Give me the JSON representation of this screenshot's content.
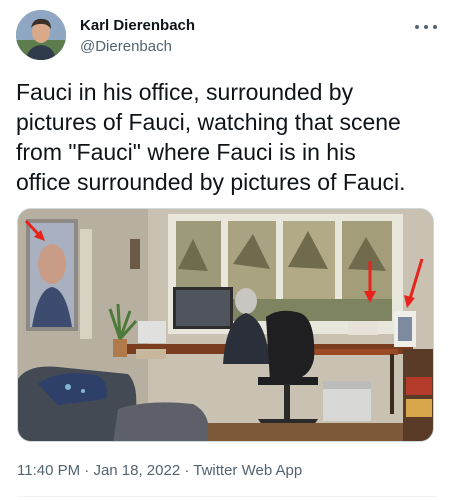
{
  "author": {
    "display_name": "Karl Dierenbach",
    "handle": "@Dierenbach",
    "avatar_icon": "profile-photo"
  },
  "tweet": {
    "text": "Fauci in his office, surrounded by\npictures of Fauci, watching that scene\nfrom \"Fauci\" where Fauci is in his\noffice surrounded by pictures of Fauci."
  },
  "meta": {
    "time": "11:40 PM",
    "separator1": " · ",
    "date": "Jan 18, 2022",
    "separator2": " · ",
    "source": "Twitter Web App"
  },
  "icons": {
    "more": "more-dots-icon"
  },
  "colors": {
    "text_primary": "#0f1419",
    "text_secondary": "#536471",
    "border": "#cfd9de",
    "arrow_red": "#e8231c"
  }
}
